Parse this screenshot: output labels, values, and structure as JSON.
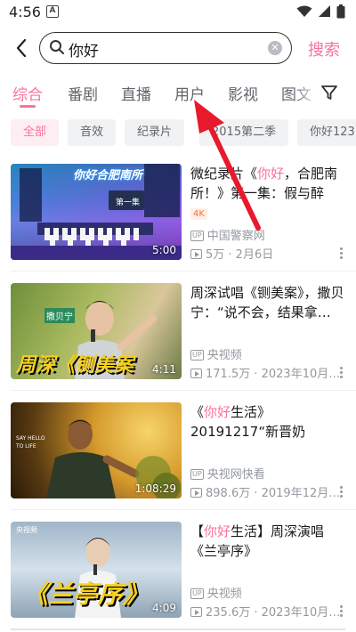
{
  "status_bar": {
    "time": "4:56",
    "notif_icon": "A"
  },
  "search": {
    "query": "你好",
    "button": "搜索"
  },
  "tabs": [
    {
      "label": "综合",
      "active": true
    },
    {
      "label": "番剧"
    },
    {
      "label": "直播"
    },
    {
      "label": "用户"
    },
    {
      "label": "影视"
    },
    {
      "label": "图文"
    }
  ],
  "chips": [
    {
      "label": "全部",
      "active": true
    },
    {
      "label": "音效"
    },
    {
      "label": "纪录片"
    },
    {
      "label": "2015第二季"
    },
    {
      "label": "你好123"
    }
  ],
  "videos": [
    {
      "title_pre": "微纪录片《",
      "title_hl": "你好",
      "title_post": "，合肥南所！》第一集：假与醉",
      "badge": "4K",
      "duration": "5:00",
      "uploader": "中国警察网",
      "stats": "5万 · 2月6日"
    },
    {
      "title_pre": "周深试唱《铡美案》，撒贝宁：“说不会，结果拿…",
      "title_hl": "",
      "title_post": "",
      "duration": "4:11",
      "uploader": "央视频",
      "stats": "171.5万 · 2023年10月…"
    },
    {
      "title_pre": "《",
      "title_hl": "你好",
      "title_post": "生活》20191217“新晋奶爸”撒…",
      "duration": "1:08:29",
      "uploader": "央视网快看",
      "stats": "898.6万 · 2019年12月…"
    },
    {
      "title_pre": "【",
      "title_hl": "你好",
      "title_post": "生活】周深演唱《兰亭序》",
      "duration": "4:09",
      "uploader": "央视频",
      "stats": "235.6万 · 2023年10月…"
    }
  ],
  "thumb_texts": {
    "v1_logo": "你好合肥南所",
    "v1_sub": "第一集",
    "v2_caption": "周深《铡美案",
    "v2_badge": "撒贝宁",
    "v3_side": "SAY HELLO TO LIFE",
    "v4_caption": "《兰亭序》",
    "v4_logo": "央视频"
  },
  "up_tag": "UP",
  "colors": {
    "accent": "#fb7299",
    "muted": "#9499a0",
    "arrow": "#e8192c"
  }
}
